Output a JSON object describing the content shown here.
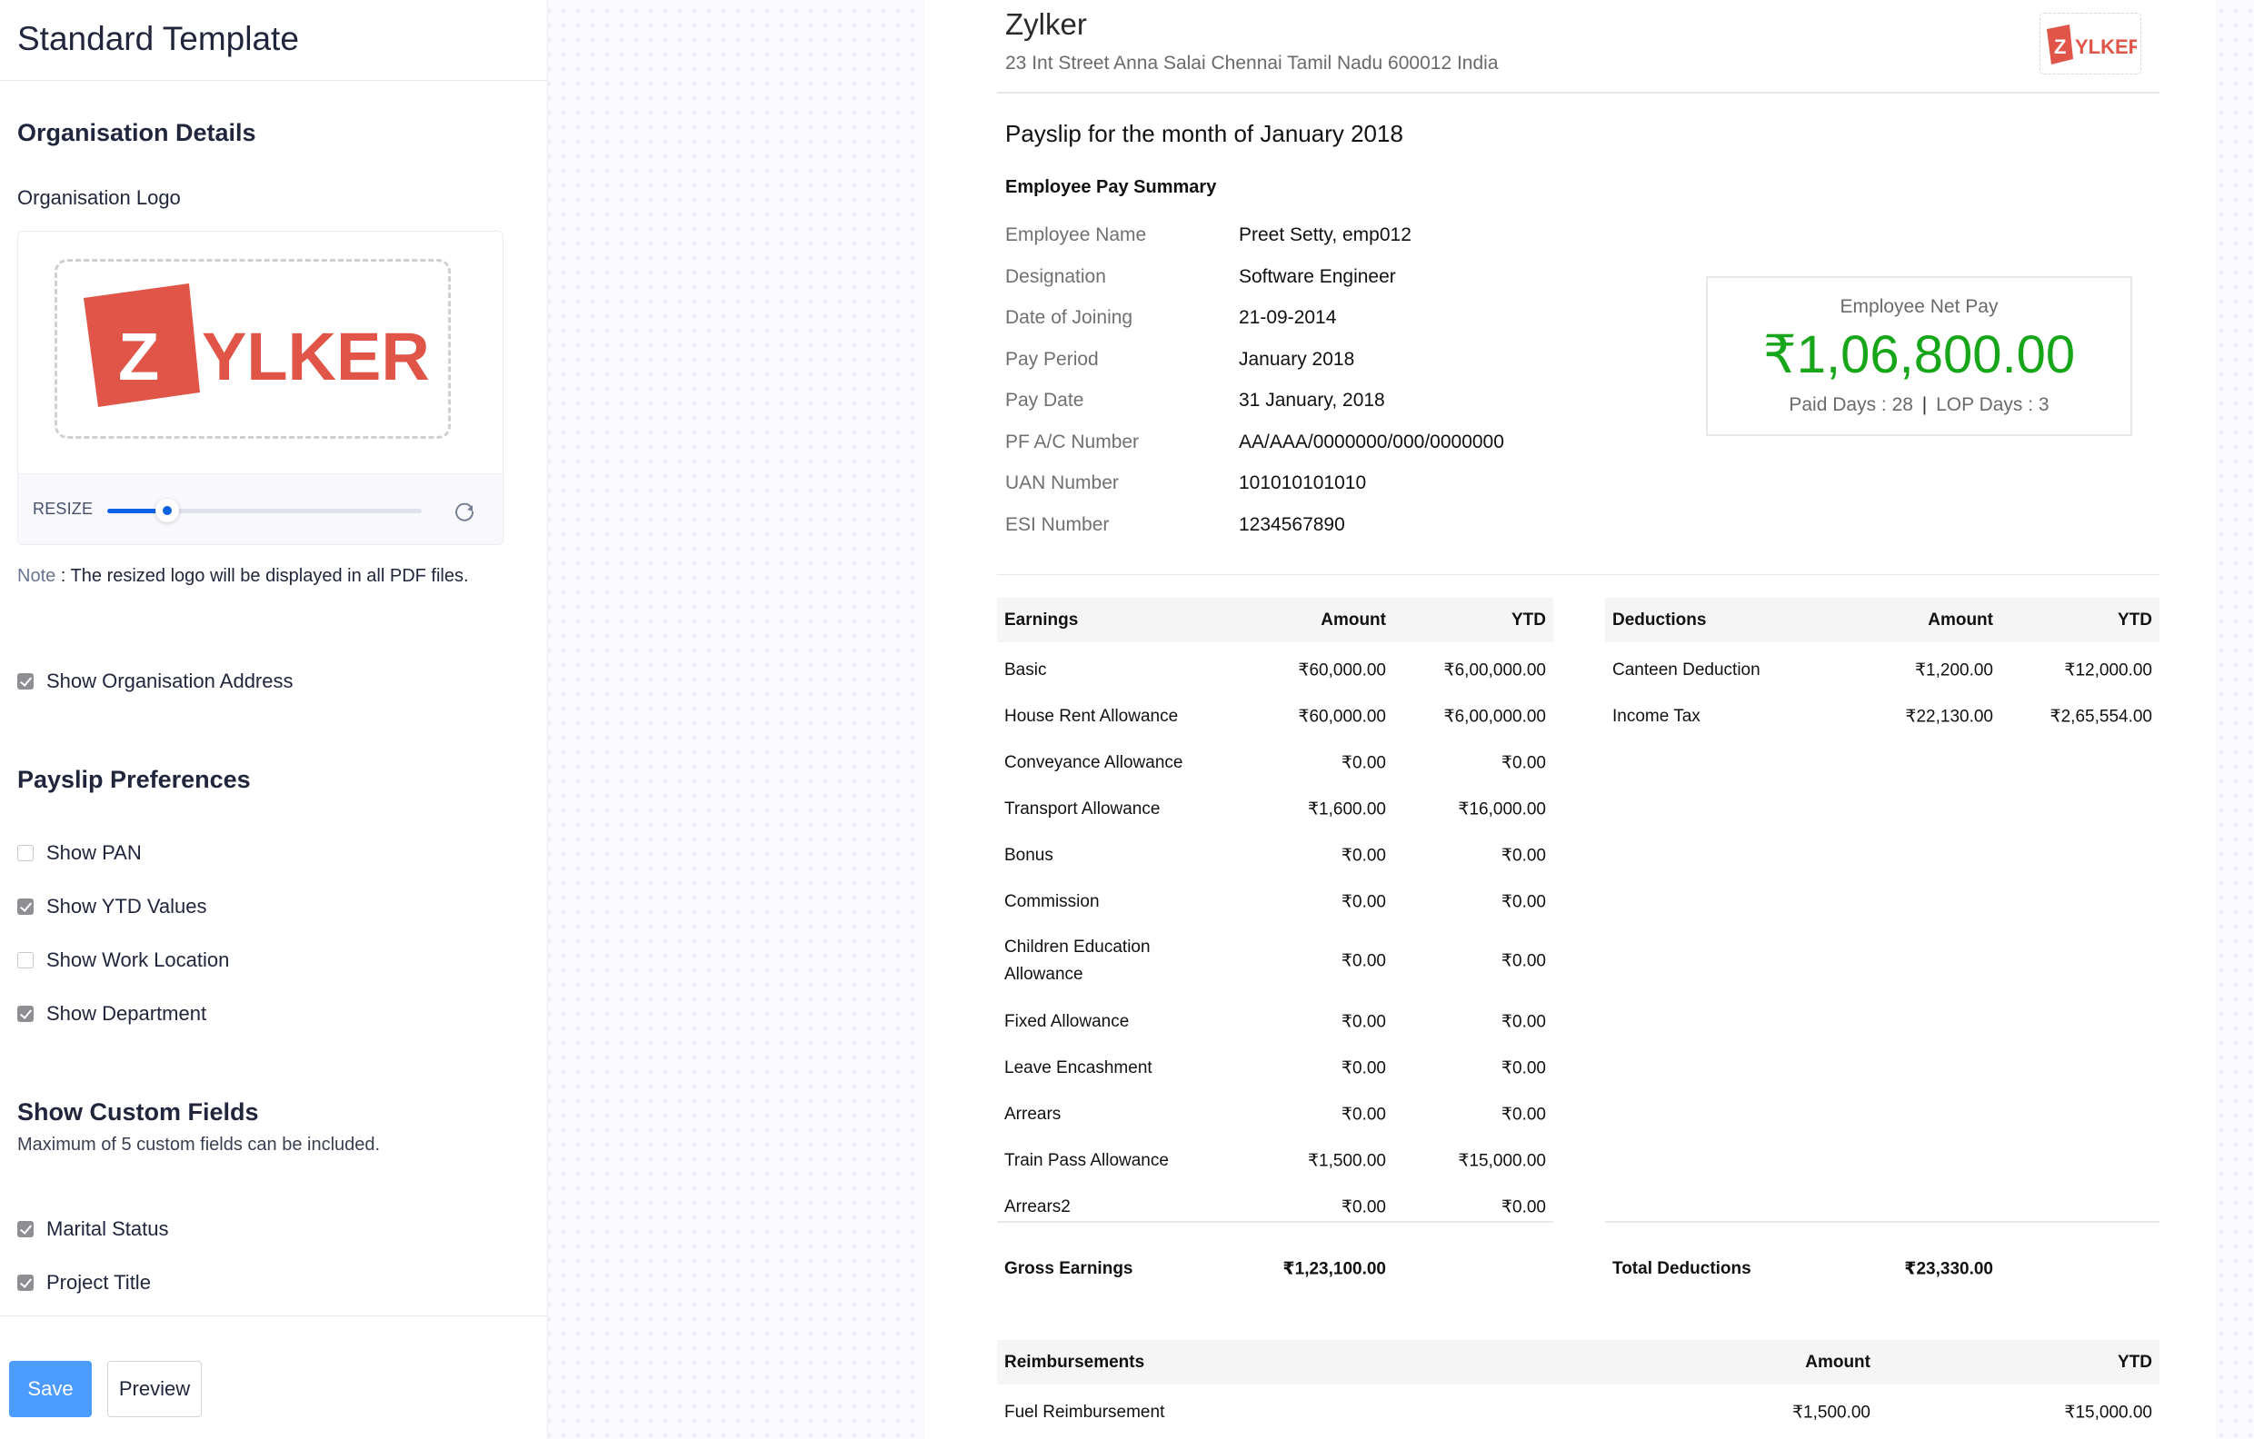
{
  "sidebar": {
    "title": "Standard Template",
    "org_details_heading": "Organisation Details",
    "org_logo_label": "Organisation Logo",
    "logo_text_box": "Z",
    "logo_text_rest": "YLKER",
    "resize_label": "RESIZE",
    "resize_value_percent": 19,
    "note_key": "Note",
    "note_text": " : The resized logo will be displayed in all PDF files.",
    "show_org_address": {
      "label": "Show Organisation Address",
      "checked": true
    },
    "payslip_prefs_heading": "Payslip Preferences",
    "payslip_prefs": [
      {
        "label": "Show PAN",
        "checked": false
      },
      {
        "label": "Show YTD Values",
        "checked": true
      },
      {
        "label": "Show Work Location",
        "checked": false
      },
      {
        "label": "Show Department",
        "checked": true
      }
    ],
    "custom_fields_heading": "Show Custom Fields",
    "custom_fields_subtitle": "Maximum of 5 custom fields can be included.",
    "custom_fields": [
      {
        "label": "Marital Status",
        "checked": true
      },
      {
        "label": "Project Title",
        "checked": true
      }
    ],
    "save_label": "Save",
    "preview_label": "Preview"
  },
  "payslip": {
    "org_name": "Zylker",
    "org_address": "23 Int Street Anna Salai Chennai Tamil Nadu 600012 India",
    "title": "Payslip for the month of January 2018",
    "summary_heading": "Employee Pay Summary",
    "summary": [
      {
        "label": "Employee Name",
        "value": "Preet Setty, emp012"
      },
      {
        "label": "Designation",
        "value": "Software Engineer"
      },
      {
        "label": "Date of Joining",
        "value": "21-09-2014"
      },
      {
        "label": "Pay Period",
        "value": "January 2018"
      },
      {
        "label": "Pay Date",
        "value": "31 January, 2018"
      },
      {
        "label": "PF A/C Number",
        "value": "AA/AAA/0000000/000/0000000"
      },
      {
        "label": "UAN Number",
        "value": "101010101010"
      },
      {
        "label": "ESI Number",
        "value": "1234567890"
      }
    ],
    "net_pay": {
      "label": "Employee Net Pay",
      "amount": "₹1,06,800.00",
      "paid_days_text": "Paid Days : 28",
      "separator": "|",
      "lop_days_text": "LOP Days : 3"
    },
    "earnings": {
      "headers": [
        "Earnings",
        "Amount",
        "YTD"
      ],
      "rows": [
        {
          "name": "Basic",
          "amount": "₹60,000.00",
          "ytd": "₹6,00,000.00"
        },
        {
          "name": "House Rent Allowance",
          "amount": "₹60,000.00",
          "ytd": "₹6,00,000.00"
        },
        {
          "name": "Conveyance Allowance",
          "amount": "₹0.00",
          "ytd": "₹0.00"
        },
        {
          "name": "Transport Allowance",
          "amount": "₹1,600.00",
          "ytd": "₹16,000.00"
        },
        {
          "name": "Bonus",
          "amount": "₹0.00",
          "ytd": "₹0.00"
        },
        {
          "name": "Commission",
          "amount": "₹0.00",
          "ytd": "₹0.00"
        },
        {
          "name": "Children Education Allowance",
          "amount": "₹0.00",
          "ytd": "₹0.00"
        },
        {
          "name": "Fixed Allowance",
          "amount": "₹0.00",
          "ytd": "₹0.00"
        },
        {
          "name": "Leave Encashment",
          "amount": "₹0.00",
          "ytd": "₹0.00"
        },
        {
          "name": "Arrears",
          "amount": "₹0.00",
          "ytd": "₹0.00"
        },
        {
          "name": "Train Pass Allowance",
          "amount": "₹1,500.00",
          "ytd": "₹15,000.00"
        },
        {
          "name": "Arrears2",
          "amount": "₹0.00",
          "ytd": "₹0.00"
        }
      ],
      "total_label": "Gross Earnings",
      "total_amount": "₹1,23,100.00"
    },
    "deductions": {
      "headers": [
        "Deductions",
        "Amount",
        "YTD"
      ],
      "rows": [
        {
          "name": "Canteen Deduction",
          "amount": "₹1,200.00",
          "ytd": "₹12,000.00"
        },
        {
          "name": "Income Tax",
          "amount": "₹22,130.00",
          "ytd": "₹2,65,554.00"
        }
      ],
      "total_label": "Total Deductions",
      "total_amount": "₹23,330.00"
    },
    "reimbursements": {
      "headers": [
        "Reimbursements",
        "Amount",
        "YTD"
      ],
      "rows": [
        {
          "name": "Fuel Reimbursement",
          "amount": "₹1,500.00",
          "ytd": "₹15,000.00"
        }
      ]
    }
  },
  "colors": {
    "accent_blue": "#0a62e6",
    "save_button": "#4c9bff",
    "logo_red": "#e05548",
    "net_pay_green": "#17a61a"
  }
}
